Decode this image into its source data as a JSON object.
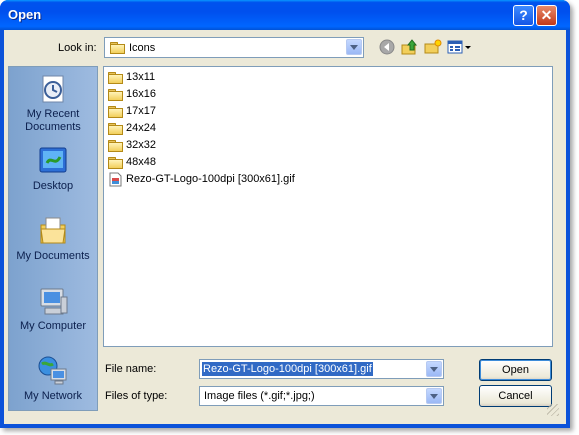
{
  "window": {
    "title": "Open"
  },
  "titlebar": {
    "help_glyph": "?",
    "close_glyph": "✕"
  },
  "lookin": {
    "label": "Look in:",
    "value": "Icons"
  },
  "toolbar": {
    "back_icon": "back-icon",
    "up_icon": "up-folder-icon",
    "newfolder_icon": "new-folder-icon",
    "views_icon": "views-menu-icon"
  },
  "places": [
    {
      "label": "My Recent Documents",
      "icon": "recent-documents-icon"
    },
    {
      "label": "Desktop",
      "icon": "desktop-icon"
    },
    {
      "label": "My Documents",
      "icon": "my-documents-icon"
    },
    {
      "label": "My Computer",
      "icon": "my-computer-icon"
    },
    {
      "label": "My Network",
      "icon": "my-network-icon"
    }
  ],
  "files": [
    {
      "name": "13x11",
      "type": "folder"
    },
    {
      "name": "16x16",
      "type": "folder"
    },
    {
      "name": "17x17",
      "type": "folder"
    },
    {
      "name": "24x24",
      "type": "folder"
    },
    {
      "name": "32x32",
      "type": "folder"
    },
    {
      "name": "48x48",
      "type": "folder"
    },
    {
      "name": "Rezo-GT-Logo-100dpi [300x61].gif",
      "type": "gif"
    }
  ],
  "filename": {
    "label": "File name:",
    "value": "Rezo-GT-Logo-100dpi [300x61].gif"
  },
  "filetype": {
    "label": "Files of type:",
    "value": "Image files (*.gif;*.jpg;)"
  },
  "buttons": {
    "open": "Open",
    "cancel": "Cancel"
  },
  "colors": {
    "title_blue": "#0053ee",
    "dialog_bg": "#ece9d8",
    "selection": "#316ac5"
  }
}
